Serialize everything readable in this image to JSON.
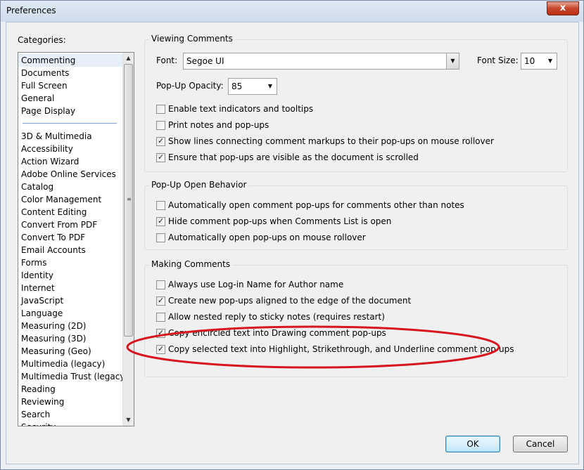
{
  "window": {
    "title": "Preferences",
    "close_label": "x"
  },
  "categories": {
    "label": "Categories:",
    "top_items": [
      "Commenting",
      "Documents",
      "Full Screen",
      "General",
      "Page Display"
    ],
    "items": [
      "3D & Multimedia",
      "Accessibility",
      "Action Wizard",
      "Adobe Online Services",
      "Catalog",
      "Color Management",
      "Content Editing",
      "Convert From PDF",
      "Convert To PDF",
      "Email Accounts",
      "Forms",
      "Identity",
      "Internet",
      "JavaScript",
      "Language",
      "Measuring (2D)",
      "Measuring (3D)",
      "Measuring (Geo)",
      "Multimedia (legacy)",
      "Multimedia Trust (legacy)",
      "Reading",
      "Reviewing",
      "Search",
      "Security"
    ],
    "selected": "Commenting"
  },
  "viewing": {
    "title": "Viewing Comments",
    "font_label": "Font:",
    "font_value": "Segoe UI",
    "font_size_label": "Font Size:",
    "font_size_value": "10",
    "opacity_label": "Pop-Up Opacity:",
    "opacity_value": "85",
    "checks": [
      {
        "label": "Enable text indicators and tooltips",
        "checked": false
      },
      {
        "label": "Print notes and pop-ups",
        "checked": false
      },
      {
        "label": "Show lines connecting comment markups to their pop-ups on mouse rollover",
        "checked": true
      },
      {
        "label": "Ensure that pop-ups are visible as the document is scrolled",
        "checked": true
      }
    ]
  },
  "popup": {
    "title": "Pop-Up Open Behavior",
    "checks": [
      {
        "label": "Automatically open comment pop-ups for comments other than notes",
        "checked": false
      },
      {
        "label": "Hide comment pop-ups when Comments List is open",
        "checked": true
      },
      {
        "label": "Automatically open pop-ups on mouse rollover",
        "checked": false
      }
    ]
  },
  "making": {
    "title": "Making Comments",
    "checks": [
      {
        "label": "Always use Log-in Name for Author name",
        "checked": false
      },
      {
        "label": "Create new pop-ups aligned to the edge of the document",
        "checked": true
      },
      {
        "label": "Allow nested reply to sticky notes (requires restart)",
        "checked": false
      },
      {
        "label": "Copy encircled text into Drawing comment pop-ups",
        "checked": true
      },
      {
        "label": "Copy selected text into Highlight, Strikethrough, and Underline comment pop-ups",
        "checked": true
      }
    ]
  },
  "buttons": {
    "ok": "OK",
    "cancel": "Cancel"
  },
  "colors": {
    "annotation": "#d8141e",
    "accent": "#3c7fb1"
  }
}
